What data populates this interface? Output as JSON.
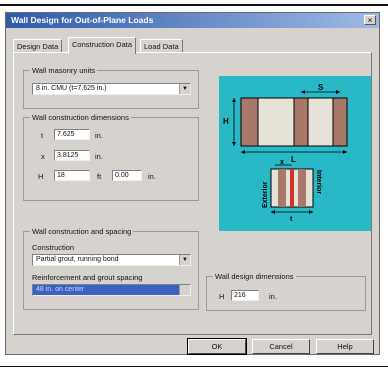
{
  "window": {
    "title": "Wall Design for Out-of-Plane Loads",
    "close_glyph": "×"
  },
  "tabs": [
    {
      "label": "Design Data"
    },
    {
      "label": "Construction Data"
    },
    {
      "label": "Load Data"
    }
  ],
  "masonry": {
    "legend": "Wall masonry units",
    "selected": "8 in. CMU (t=7.625 in.)"
  },
  "dimensions": {
    "legend": "Wall construction dimensions",
    "t": {
      "label": "t",
      "value": "7.625",
      "unit": "in."
    },
    "x": {
      "label": "x",
      "value": "3.8125",
      "unit": "in."
    },
    "H": {
      "label": "H",
      "ft_value": "18",
      "ft_unit": "ft",
      "in_value": "0.00",
      "in_unit": "in."
    }
  },
  "construction": {
    "legend": "Wall construction and spacing",
    "construction_label": "Construction",
    "construction_value": "Partial grout, running bond",
    "reinforcement_label": "Reinforcement and grout spacing",
    "reinforcement_value": "48 in. on center"
  },
  "design_dims": {
    "legend": "Wall design dimensions",
    "H_label": "H",
    "H_value": "216",
    "H_unit": "in."
  },
  "diagram": {
    "labels": {
      "S": "S",
      "H": "H",
      "L": "L",
      "x": "x",
      "t": "t",
      "exterior": "Exterior",
      "interior": "Interior"
    }
  },
  "buttons": {
    "ok": "OK",
    "cancel": "Cancel",
    "help": "Help"
  },
  "icons": {
    "dropdown": "chevron-down-icon"
  }
}
